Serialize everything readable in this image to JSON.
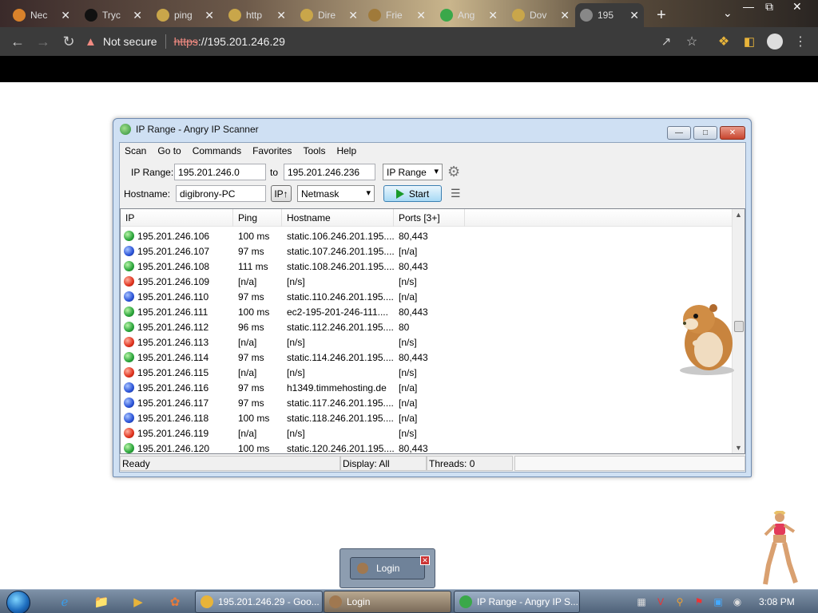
{
  "browser": {
    "tabs": [
      {
        "title": "Nec",
        "color": "#d9822b"
      },
      {
        "title": "Tryc",
        "color": "#111111"
      },
      {
        "title": "ping",
        "color": "#c9a64a"
      },
      {
        "title": "http",
        "color": "#c9a64a"
      },
      {
        "title": "Dire",
        "color": "#c9a64a"
      },
      {
        "title": "Frie",
        "color": "#a07a3a"
      },
      {
        "title": "Ang",
        "color": "#3aa84a"
      },
      {
        "title": "Dov",
        "color": "#c9a64a"
      },
      {
        "title": "195",
        "color": "#888888"
      }
    ],
    "new_tab": "+",
    "security_label": "Not secure",
    "url_scheme": "https",
    "url_rest": "://195.201.246.29"
  },
  "app": {
    "title": "IP Range - Angry IP Scanner",
    "menu": [
      "Scan",
      "Go to",
      "Commands",
      "Favorites",
      "Tools",
      "Help"
    ],
    "ip_range_label": "IP Range:",
    "ip_from": "195.201.246.0",
    "to_label": "to",
    "ip_to": "195.201.246.236",
    "feeder": "IP Range",
    "hostname_label": "Hostname:",
    "hostname": "digibrony-PC",
    "ip_up_button": "IP↑",
    "netmask": "Netmask",
    "start_button": "Start",
    "columns": [
      "IP",
      "Ping",
      "Hostname",
      "Ports [3+]"
    ],
    "rows": [
      {
        "status": "alive",
        "ip": "195.201.246.106",
        "ping": "100 ms",
        "hostname": "static.106.246.201.195....",
        "ports": "80,443"
      },
      {
        "status": "unknown",
        "ip": "195.201.246.107",
        "ping": "97 ms",
        "hostname": "static.107.246.201.195....",
        "ports": "[n/a]"
      },
      {
        "status": "alive",
        "ip": "195.201.246.108",
        "ping": "111 ms",
        "hostname": "static.108.246.201.195....",
        "ports": "80,443"
      },
      {
        "status": "dead",
        "ip": "195.201.246.109",
        "ping": "[n/a]",
        "hostname": "[n/s]",
        "ports": "[n/s]"
      },
      {
        "status": "unknown",
        "ip": "195.201.246.110",
        "ping": "97 ms",
        "hostname": "static.110.246.201.195....",
        "ports": "[n/a]"
      },
      {
        "status": "alive",
        "ip": "195.201.246.111",
        "ping": "100 ms",
        "hostname": "ec2-195-201-246-111....",
        "ports": "80,443"
      },
      {
        "status": "alive",
        "ip": "195.201.246.112",
        "ping": "96 ms",
        "hostname": "static.112.246.201.195....",
        "ports": "80"
      },
      {
        "status": "dead",
        "ip": "195.201.246.113",
        "ping": "[n/a]",
        "hostname": "[n/s]",
        "ports": "[n/s]"
      },
      {
        "status": "alive",
        "ip": "195.201.246.114",
        "ping": "97 ms",
        "hostname": "static.114.246.201.195....",
        "ports": "80,443"
      },
      {
        "status": "dead",
        "ip": "195.201.246.115",
        "ping": "[n/a]",
        "hostname": "[n/s]",
        "ports": "[n/s]"
      },
      {
        "status": "unknown",
        "ip": "195.201.246.116",
        "ping": "97 ms",
        "hostname": "h1349.timmehosting.de",
        "ports": "[n/a]"
      },
      {
        "status": "unknown",
        "ip": "195.201.246.117",
        "ping": "97 ms",
        "hostname": "static.117.246.201.195....",
        "ports": "[n/a]"
      },
      {
        "status": "unknown",
        "ip": "195.201.246.118",
        "ping": "100 ms",
        "hostname": "static.118.246.201.195....",
        "ports": "[n/a]"
      },
      {
        "status": "dead",
        "ip": "195.201.246.119",
        "ping": "[n/a]",
        "hostname": "[n/s]",
        "ports": "[n/s]"
      },
      {
        "status": "alive",
        "ip": "195.201.246.120",
        "ping": "100 ms",
        "hostname": "static.120.246.201.195....",
        "ports": "80,443"
      }
    ],
    "status_ready": "Ready",
    "status_display": "Display: All",
    "status_threads": "Threads: 0"
  },
  "login_popup": {
    "label": "Login"
  },
  "taskbar": {
    "items": [
      {
        "label": "195.201.246.29 - Goo...",
        "icon_color": "#e8b43a"
      },
      {
        "label": "Login",
        "icon_color": "#a07850"
      },
      {
        "label": "IP Range - Angry IP S...",
        "icon_color": "#3aa84a"
      }
    ],
    "clock": "3:08 PM"
  }
}
